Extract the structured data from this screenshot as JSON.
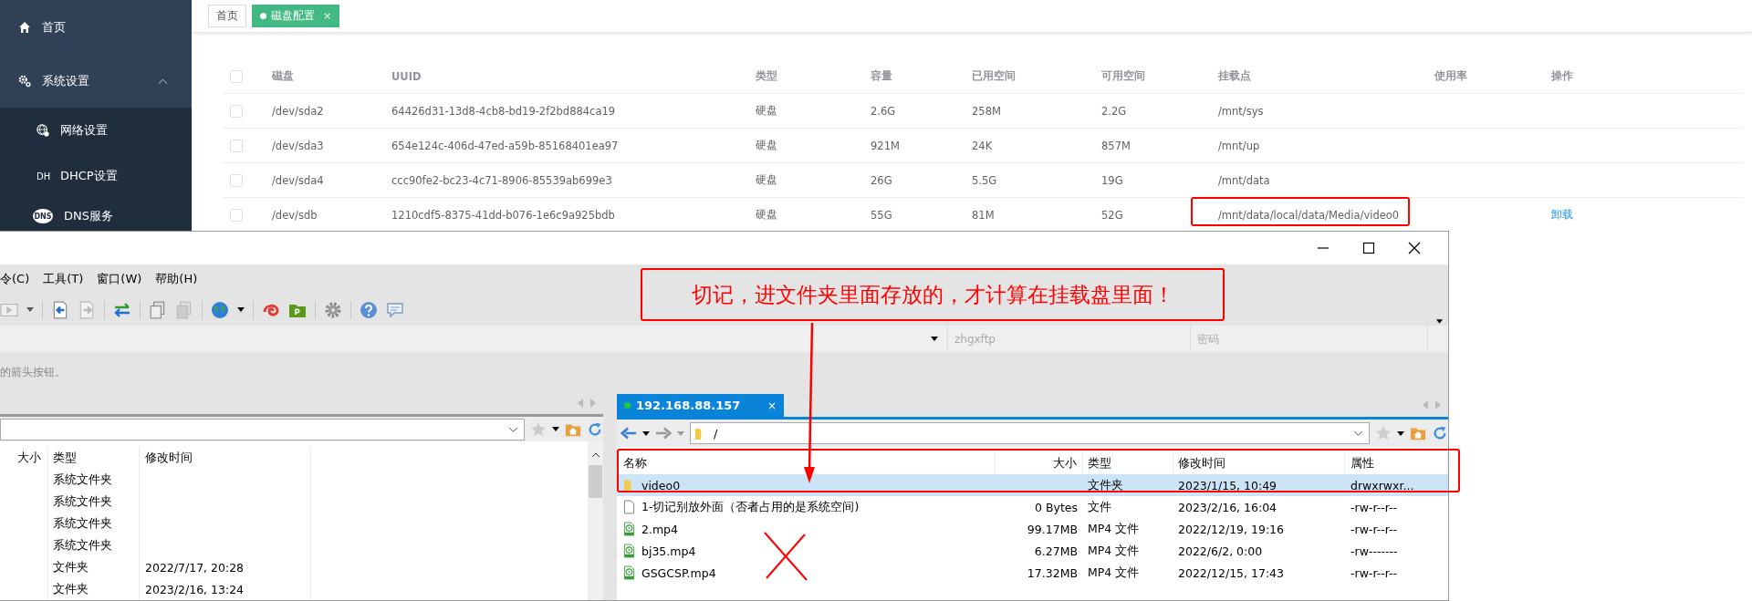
{
  "sidebar": {
    "items": [
      {
        "label": "首页"
      },
      {
        "label": "系统设置",
        "expanded": true,
        "children": [
          {
            "label": "网络设置"
          },
          {
            "label": "DHCP设置",
            "icon_text": "DH"
          },
          {
            "label": "DNS服务",
            "icon_text": "DNS"
          }
        ]
      }
    ]
  },
  "tabs": [
    {
      "label": "首页",
      "selected": false
    },
    {
      "label": "磁盘配置",
      "selected": true,
      "close_label": "×"
    }
  ],
  "disk_table": {
    "header_checked": false,
    "columns": [
      "磁盘",
      "UUID",
      "类型",
      "容量",
      "已用空间",
      "可用空间",
      "挂载点",
      "使用率",
      "操作"
    ],
    "rows": [
      {
        "checked": false,
        "disk": "/dev/sda2",
        "uuid": "64426d31-13d8-4cb8-bd19-2f2bd884ca19",
        "type": "硬盘",
        "capacity": "2.6G",
        "used": "258M",
        "free": "2.2G",
        "mount": "/mnt/sys"
      },
      {
        "checked": false,
        "disk": "/dev/sda3",
        "uuid": "654e124c-406d-47ed-a59b-85168401ea97",
        "type": "硬盘",
        "capacity": "921M",
        "used": "24K",
        "free": "857M",
        "mount": "/mnt/up"
      },
      {
        "checked": false,
        "disk": "/dev/sda4",
        "uuid": "ccc90fe2-bc23-4c71-8906-85539ab699e3",
        "type": "硬盘",
        "capacity": "26G",
        "used": "5.5G",
        "free": "19G",
        "mount": "/mnt/data"
      },
      {
        "checked": false,
        "disk": "/dev/sdb",
        "uuid": "1210cdf5-8375-41dd-b076-1e6c9a925bdb",
        "type": "硬盘",
        "capacity": "55G",
        "used": "81M",
        "free": "52G",
        "mount": "/mnt/data/local/data/Media/video0",
        "action": "卸载"
      }
    ]
  },
  "ftp_window": {
    "menu": [
      "令(C)",
      "工具(T)",
      "窗口(W)",
      "帮助(H)"
    ],
    "connection": {
      "user_placeholder": "zhgxftp",
      "password_placeholder": "密码"
    },
    "hint": "的箭头按钮。",
    "local_pane": {
      "columns": [
        "大小",
        "类型",
        "修改时间"
      ],
      "rows": [
        {
          "type": "系统文件夹"
        },
        {
          "type": "系统文件夹"
        },
        {
          "type": "系统文件夹"
        },
        {
          "type": "系统文件夹"
        },
        {
          "type": "文件夹",
          "modified": "2022/7/17, 20:28"
        },
        {
          "type": "文件夹",
          "modified": "2023/2/16, 13:24"
        }
      ]
    },
    "remote_pane": {
      "tab": {
        "label": "192.168.88.157",
        "connected": true,
        "close_label": "×"
      },
      "path": "/",
      "columns": [
        "名称",
        "大小",
        "类型",
        "修改时间",
        "属性"
      ],
      "rows": [
        {
          "kind": "folder",
          "selected": true,
          "name": "video0",
          "type": "文件夹",
          "modified": "2023/1/15, 10:49",
          "attributes": "drwxrwxr..."
        },
        {
          "kind": "file",
          "selected": false,
          "name": "1-切记别放外面（否者占用的是系统空间)",
          "size": "0 Bytes",
          "type": "文件",
          "modified": "2023/2/16, 16:04",
          "attributes": "-rw-r--r--"
        },
        {
          "kind": "video",
          "selected": false,
          "name": "2.mp4",
          "size": "99.17MB",
          "type": "MP4 文件",
          "modified": "2022/12/19, 19:16",
          "attributes": "-rw-r--r--"
        },
        {
          "kind": "video",
          "selected": false,
          "name": "bj35.mp4",
          "size": "6.27MB",
          "type": "MP4 文件",
          "modified": "2022/6/2, 0:00",
          "attributes": "-rw-------"
        },
        {
          "kind": "video",
          "selected": false,
          "name": "GSGCSP.mp4",
          "size": "17.32MB",
          "type": "MP4 文件",
          "modified": "2022/12/15, 17:43",
          "attributes": "-rw-r--r--"
        }
      ]
    }
  },
  "annotation": {
    "note": "切记，进文件夹里面存放的，才计算在挂载盘里面！"
  }
}
